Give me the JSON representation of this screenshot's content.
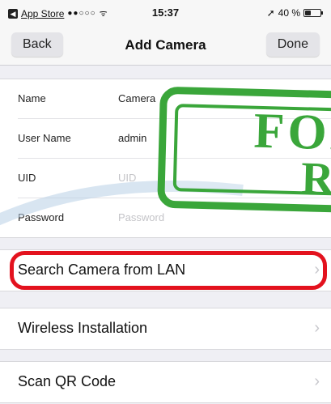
{
  "status_bar": {
    "carrier": "App Store",
    "signal": "●●○○○",
    "time": "15:37",
    "battery_text": "40 %",
    "battery_level": 0.4
  },
  "nav": {
    "back_label": "Back",
    "title": "Add Camera",
    "done_label": "Done"
  },
  "form": {
    "rows": [
      {
        "label": "Name",
        "value": "Camera",
        "placeholder": ""
      },
      {
        "label": "User Name",
        "value": "admin",
        "placeholder": ""
      },
      {
        "label": "UID",
        "value": "",
        "placeholder": "UID"
      },
      {
        "label": "Password",
        "value": "",
        "placeholder": "Password"
      }
    ]
  },
  "actions": {
    "search_lan": "Search Camera from LAN",
    "wireless": "Wireless Installation",
    "scan_qr": "Scan QR Code"
  },
  "stamp": {
    "line1": "FOR",
    "line2": "R"
  },
  "colors": {
    "highlight": "#e3121e",
    "stamp": "#3aa63a"
  }
}
